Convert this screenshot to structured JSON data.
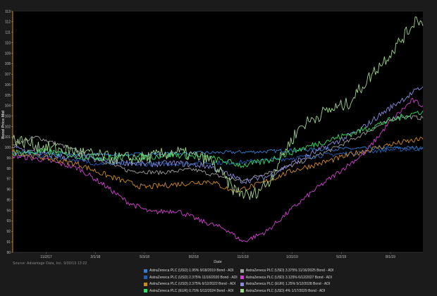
{
  "chart_data": {
    "type": "line",
    "title": "",
    "xlabel": "Date",
    "ylabel": "Bond Price Mid",
    "ylim": [
      90,
      113
    ],
    "y_ticks": [
      90,
      91,
      92,
      93,
      94,
      95,
      96,
      97,
      98,
      99,
      100,
      101,
      102,
      103,
      104,
      105,
      106,
      107,
      108,
      109,
      110,
      111,
      112,
      113
    ],
    "x_range": [
      "2017-09-01",
      "2019-09-30"
    ],
    "x_ticks": [
      {
        "date": "2017-11-02",
        "label": "11/2/17"
      },
      {
        "date": "2018-02-01",
        "label": "2/1/18"
      },
      {
        "date": "2018-05-03",
        "label": "5/3/18"
      },
      {
        "date": "2018-08-02",
        "label": "8/2/18"
      },
      {
        "date": "2018-11-01",
        "label": "11/1/18"
      },
      {
        "date": "2019-01-31",
        "label": "1/31/19"
      },
      {
        "date": "2019-05-02",
        "label": "5/2/19"
      },
      {
        "date": "2019-08-01",
        "label": "8/1/19"
      }
    ],
    "grid": false,
    "legend_position": "bottom",
    "series": [
      {
        "name": "AstraZeneca PLC (USD) 1.95% 9/18/2019 Bond - ADI",
        "color": "#2f7fd6",
        "points": [
          [
            "2017-09-01",
            99.5
          ],
          [
            "2017-12-01",
            99.4
          ],
          [
            "2018-03-01",
            99.3
          ],
          [
            "2018-06-01",
            99.4
          ],
          [
            "2018-09-01",
            99.5
          ],
          [
            "2018-12-01",
            99.6
          ],
          [
            "2019-03-01",
            99.8
          ],
          [
            "2019-06-01",
            99.9
          ],
          [
            "2019-09-30",
            100.0
          ]
        ]
      },
      {
        "name": "AstraZeneca PLC (USD) 3.375% 11/16/2025 Bond - ADI",
        "color": "#a0a0a0",
        "points": [
          [
            "2017-09-01",
            100.3
          ],
          [
            "2017-10-15",
            101.0
          ],
          [
            "2017-12-01",
            100.2
          ],
          [
            "2018-02-01",
            99.0
          ],
          [
            "2018-04-01",
            97.8
          ],
          [
            "2018-06-01",
            97.6
          ],
          [
            "2018-08-01",
            97.9
          ],
          [
            "2018-09-15",
            97.3
          ],
          [
            "2018-11-01",
            96.8
          ],
          [
            "2018-12-15",
            97.6
          ],
          [
            "2019-02-01",
            98.3
          ],
          [
            "2019-04-01",
            99.5
          ],
          [
            "2019-06-01",
            101.0
          ],
          [
            "2019-07-15",
            102.2
          ],
          [
            "2019-08-20",
            103.0
          ],
          [
            "2019-09-30",
            102.8
          ]
        ]
      },
      {
        "name": "AstraZeneca PLC (USD) 2.375% 11/16/2020 Bond - ADI",
        "color": "#2060b8",
        "points": [
          [
            "2017-09-01",
            99.4
          ],
          [
            "2017-12-01",
            99.0
          ],
          [
            "2018-02-01",
            98.5
          ],
          [
            "2018-05-01",
            98.4
          ],
          [
            "2018-08-01",
            98.5
          ],
          [
            "2018-11-01",
            98.6
          ],
          [
            "2019-02-01",
            99.0
          ],
          [
            "2019-05-01",
            99.4
          ],
          [
            "2019-08-01",
            99.8
          ],
          [
            "2019-09-30",
            99.9
          ]
        ]
      },
      {
        "name": "AstraZeneca PLC (USD) 3.125% 6/12/2027 Bond - ADI",
        "color": "#d040d0",
        "points": [
          [
            "2017-09-01",
            99.2
          ],
          [
            "2017-11-01",
            98.8
          ],
          [
            "2018-01-01",
            98.0
          ],
          [
            "2018-02-15",
            96.5
          ],
          [
            "2018-04-01",
            94.8
          ],
          [
            "2018-05-15",
            93.8
          ],
          [
            "2018-07-01",
            94.0
          ],
          [
            "2018-08-15",
            93.0
          ],
          [
            "2018-10-01",
            92.2
          ],
          [
            "2018-11-01",
            91.0
          ],
          [
            "2018-12-15",
            92.0
          ],
          [
            "2019-02-01",
            94.2
          ],
          [
            "2019-03-15",
            96.0
          ],
          [
            "2019-05-01",
            97.8
          ],
          [
            "2019-06-15",
            99.5
          ],
          [
            "2019-08-01",
            102.5
          ],
          [
            "2019-09-10",
            104.5
          ],
          [
            "2019-09-30",
            104.0
          ]
        ]
      },
      {
        "name": "AstraZeneca PLC (USD) 2.375% 6/12/2022 Bond - ADI",
        "color": "#d08a1e",
        "points": [
          [
            "2017-09-01",
            99.6
          ],
          [
            "2017-11-01",
            99.0
          ],
          [
            "2018-01-01",
            98.4
          ],
          [
            "2018-03-01",
            97.2
          ],
          [
            "2018-05-01",
            96.2
          ],
          [
            "2018-07-01",
            96.5
          ],
          [
            "2018-09-01",
            96.8
          ],
          [
            "2018-10-15",
            95.8
          ],
          [
            "2018-12-01",
            96.5
          ],
          [
            "2019-02-01",
            97.8
          ],
          [
            "2019-04-01",
            98.6
          ],
          [
            "2019-06-01",
            99.5
          ],
          [
            "2019-08-01",
            100.3
          ],
          [
            "2019-09-30",
            100.8
          ]
        ]
      },
      {
        "name": "AstraZeneca PLC (EUR) 1.25% 5/12/2028 Bond - ADI",
        "color": "#8a8ae0",
        "points": [
          [
            "2017-09-01",
            100.0
          ],
          [
            "2017-11-01",
            99.3
          ],
          [
            "2018-01-01",
            99.0
          ],
          [
            "2018-03-01",
            98.7
          ],
          [
            "2018-05-01",
            98.4
          ],
          [
            "2018-07-01",
            98.5
          ],
          [
            "2018-09-01",
            98.2
          ],
          [
            "2018-11-01",
            96.8
          ],
          [
            "2018-12-15",
            97.2
          ],
          [
            "2019-02-01",
            98.5
          ],
          [
            "2019-04-01",
            100.0
          ],
          [
            "2019-06-01",
            101.5
          ],
          [
            "2019-07-15",
            103.2
          ],
          [
            "2019-08-20",
            104.5
          ],
          [
            "2019-09-30",
            105.8
          ]
        ]
      },
      {
        "name": "AstraZeneca PLC (EUR) 0.75% 5/12/2024 Bond - ADI",
        "color": "#30e060",
        "points": [
          [
            "2017-09-01",
            99.5
          ],
          [
            "2017-11-01",
            99.6
          ],
          [
            "2018-01-01",
            99.2
          ],
          [
            "2018-03-01",
            99.0
          ],
          [
            "2018-05-01",
            99.1
          ],
          [
            "2018-07-01",
            99.3
          ],
          [
            "2018-09-01",
            99.0
          ],
          [
            "2018-11-01",
            98.3
          ],
          [
            "2018-12-15",
            98.7
          ],
          [
            "2019-02-01",
            99.6
          ],
          [
            "2019-04-01",
            100.6
          ],
          [
            "2019-06-01",
            101.5
          ],
          [
            "2019-08-01",
            102.6
          ],
          [
            "2019-09-30",
            103.5
          ]
        ]
      },
      {
        "name": "AstraZeneca PLC (USD) 4% 1/17/2029 Bond - ADI",
        "color": "#9ed68a",
        "points": [
          [
            "2017-09-01",
            100.8
          ],
          [
            "2017-11-01",
            100.0
          ],
          [
            "2018-01-01",
            99.6
          ],
          [
            "2018-03-01",
            99.0
          ],
          [
            "2018-05-01",
            99.0
          ],
          [
            "2018-07-01",
            99.6
          ],
          [
            "2018-09-01",
            98.8
          ],
          [
            "2018-10-15",
            96.0
          ],
          [
            "2018-11-15",
            95.3
          ],
          [
            "2018-12-20",
            96.8
          ],
          [
            "2019-01-15",
            99.5
          ],
          [
            "2019-02-15",
            102.0
          ],
          [
            "2019-04-01",
            103.4
          ],
          [
            "2019-05-15",
            104.2
          ],
          [
            "2019-07-01",
            107.2
          ],
          [
            "2019-08-01",
            109.0
          ],
          [
            "2019-09-01",
            111.0
          ],
          [
            "2019-09-20",
            112.5
          ],
          [
            "2019-09-30",
            111.6
          ]
        ]
      }
    ]
  },
  "source_text": "Source: Advantage Data, Inc. 9/30/19 13:22"
}
